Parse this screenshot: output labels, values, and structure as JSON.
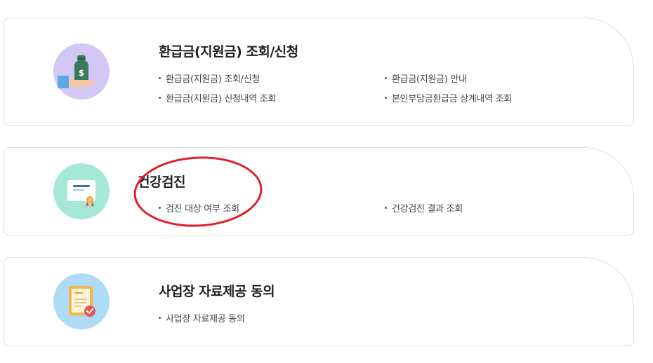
{
  "cards": [
    {
      "title": "환급금(지원금) 조회/신청",
      "icon": "money-bag-hand-icon",
      "icon_bg": "#d3c8f5",
      "links": [
        "환급금(지원금) 조회/신청",
        "환급금(지원금) 안내",
        "환급금(지원금) 신청내역 조회",
        "본인부담금환급금 상계내역 조회"
      ]
    },
    {
      "title": "건강검진",
      "icon": "certificate-icon",
      "icon_bg": "#a5e8d5",
      "links": [
        "검진 대상 여부 조회",
        "건강검진 결과 조회"
      ]
    },
    {
      "title": "사업장 자료제공 동의",
      "icon": "document-check-icon",
      "icon_bg": "#aedcf6",
      "links": [
        "사업장 자료제공 동의"
      ]
    }
  ],
  "annotation": {
    "shape": "ellipse",
    "color": "#e0202a",
    "target": "건강검진"
  }
}
